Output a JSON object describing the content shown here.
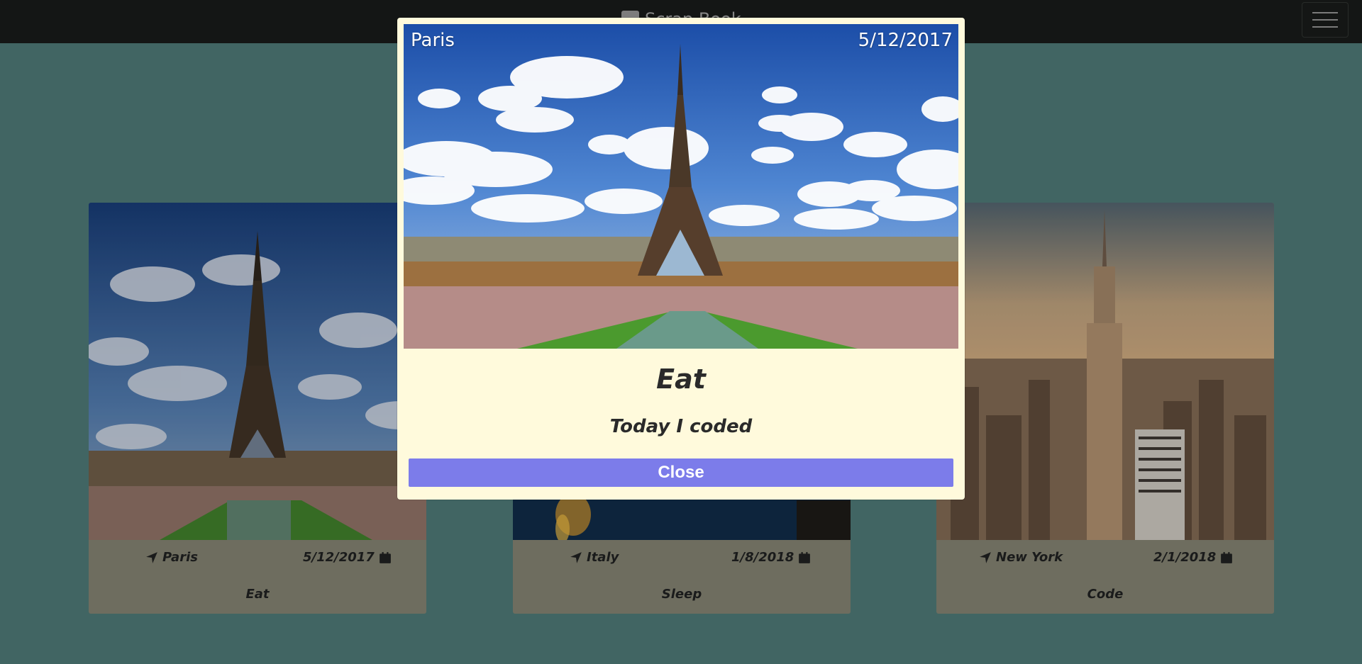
{
  "navbar": {
    "brand": "Scrap Book",
    "brand_icon": "book-icon",
    "toggler_icon": "hamburger-icon"
  },
  "cards": [
    {
      "location": "Paris",
      "date": "5/12/2017",
      "title": "Eat",
      "location_icon": "location-arrow-icon",
      "date_icon": "calendar-icon"
    },
    {
      "location": "Italy",
      "date": "1/8/2018",
      "title": "Sleep",
      "location_icon": "location-arrow-icon",
      "date_icon": "calendar-icon"
    },
    {
      "location": "New York",
      "date": "2/1/2018",
      "title": "Code",
      "location_icon": "location-arrow-icon",
      "date_icon": "calendar-icon"
    }
  ],
  "modal": {
    "location": "Paris",
    "date": "5/12/2017",
    "title": "Eat",
    "text": "Today I coded",
    "close_label": "Close",
    "button_color": "#7c7cea",
    "background_color": "#fffadc"
  }
}
